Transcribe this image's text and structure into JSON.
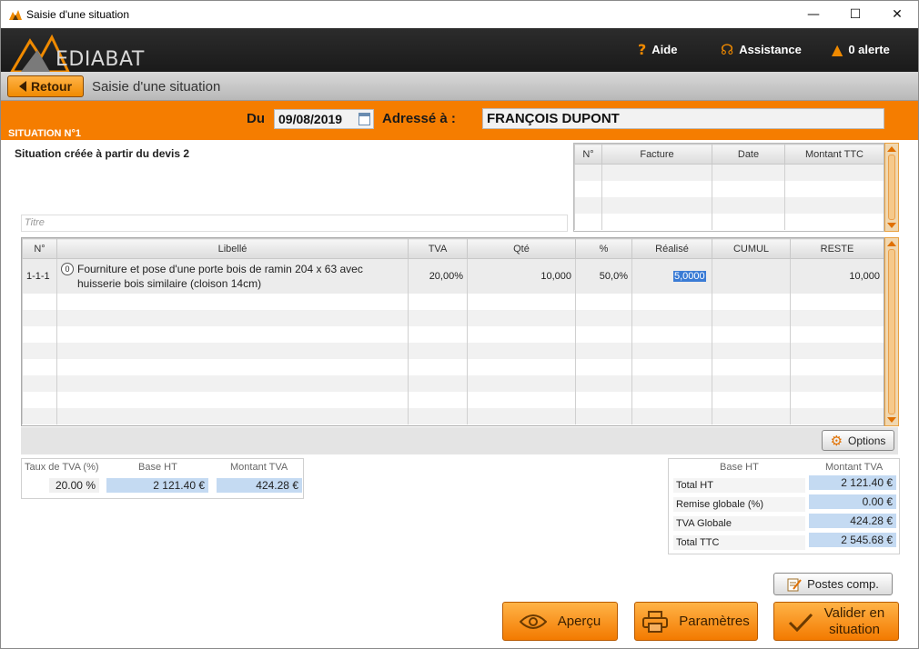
{
  "window": {
    "title": "Saisie d'une situation",
    "controls": [
      "—",
      "☐",
      "✕"
    ]
  },
  "header": {
    "logo_text": "EDIABAT",
    "aide": "Aide",
    "assistance": "Assistance",
    "alerte": "0 alerte"
  },
  "nav": {
    "back_label": "Retour",
    "page_title": "Saisie d'une situation"
  },
  "band": {
    "du_label": "Du",
    "date": "09/08/2019",
    "adresse_label": "Adressé à :",
    "client": "FRANÇOIS DUPONT",
    "situation_number": "SITUATION N°1"
  },
  "content": {
    "subtitle": "Situation créée à partir du devis 2",
    "titre_placeholder": "Titre"
  },
  "factures_table": {
    "columns": [
      "N°",
      "Facture",
      "Date",
      "Montant TTC"
    ],
    "rows": []
  },
  "main_table": {
    "columns": [
      "N°",
      "Libellé",
      "TVA",
      "Qté",
      "%",
      "Réalisé",
      "CUMUL",
      "RESTE"
    ],
    "rows": [
      {
        "num": "1-1-1",
        "badge": "0",
        "libelle_line1": "Fourniture et pose d'une porte bois de ramin 204 x 63 avec",
        "libelle_line2": "huisserie bois similaire (cloison 14cm)",
        "tva": "20,00%",
        "qte": "10,000",
        "pct": "50,0%",
        "realise": "5,0000",
        "cumul": "",
        "reste": "10,000"
      }
    ]
  },
  "options_label": "Options",
  "tva_summary": {
    "headers": [
      "Taux de TVA (%)",
      "Base HT",
      "Montant TVA"
    ],
    "row": [
      "20.00 %",
      "2 121.40 €",
      "424.28 €"
    ]
  },
  "totals": {
    "headers": [
      "Base HT",
      "Montant TVA"
    ],
    "total_ht_label": "Total HT",
    "total_ht": "2 121.40 €",
    "remise_label": "Remise globale (%)",
    "remise": "0.00 €",
    "tva_label": "TVA Globale",
    "tva": "424.28 €",
    "ttc_label": "Total TTC",
    "ttc": "2 545.68 €"
  },
  "buttons": {
    "postes": "Postes comp.",
    "apercu": "Aperçu",
    "parametres": "Paramètres",
    "valider_line1": "Valider en",
    "valider_line2": "situation"
  },
  "colors": {
    "accent": "#f57d00",
    "header_bg": "#222222",
    "highlight_blue": "#c4daf2"
  }
}
